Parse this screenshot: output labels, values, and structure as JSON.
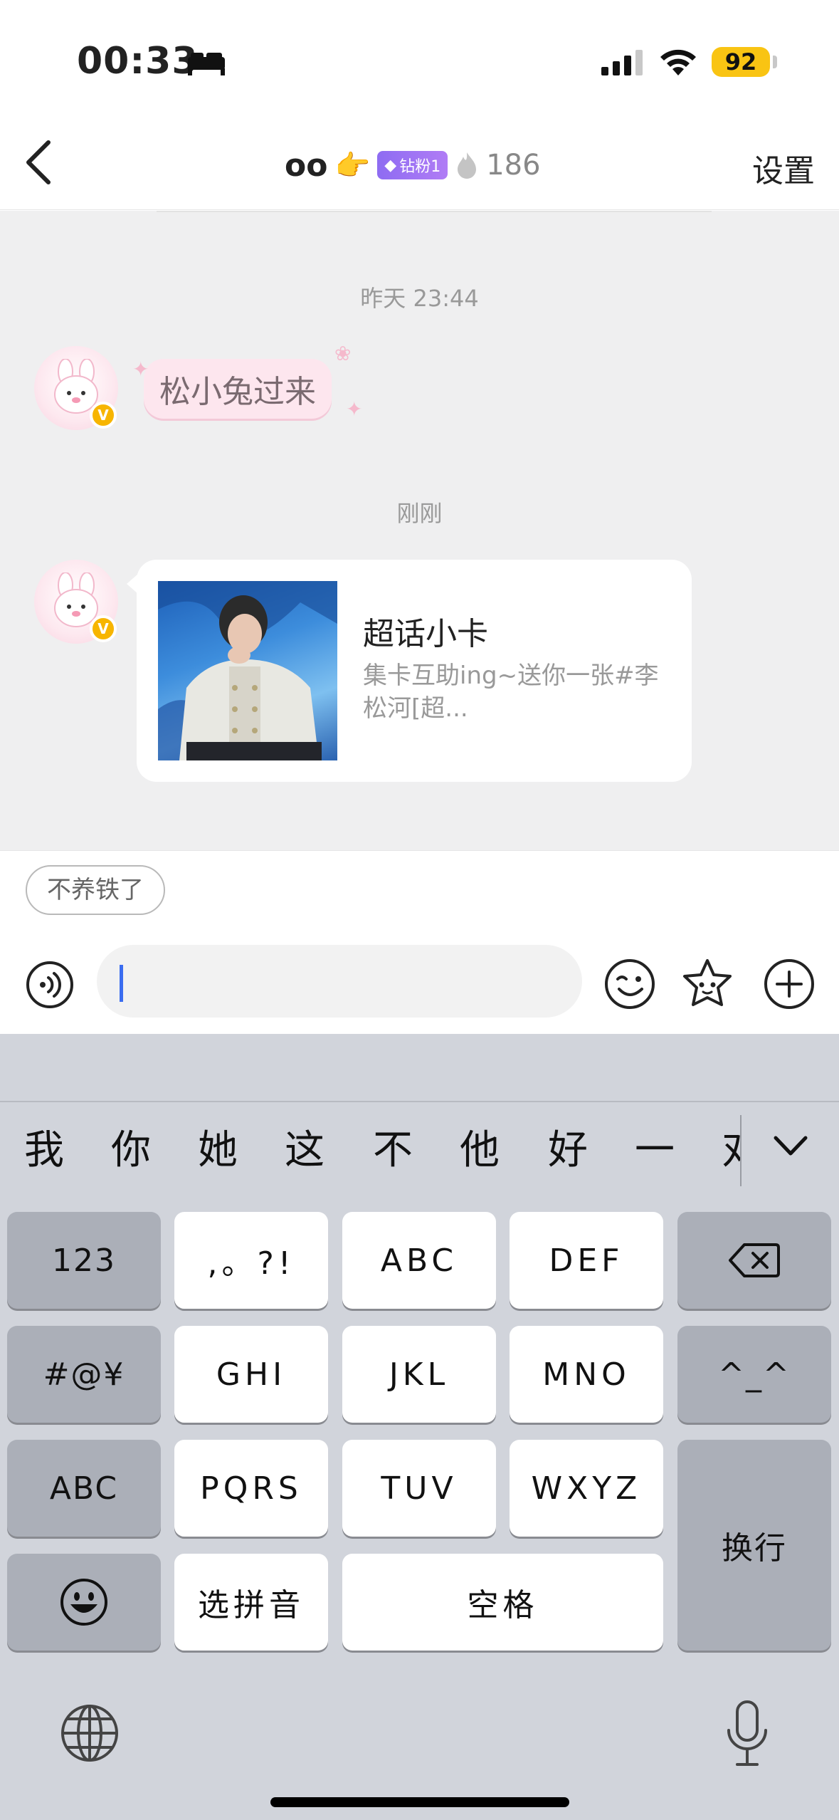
{
  "status_bar": {
    "time": "00:33",
    "battery": "92"
  },
  "nav": {
    "name": "oo",
    "name_emoji": "👉",
    "fan_badge": "钻粉1",
    "fan_count": "186",
    "settings": "设置"
  },
  "chat": {
    "messages": [
      {
        "timestamp": "昨天 23:44",
        "text": "松小兔过来"
      },
      {
        "timestamp": "刚刚",
        "card_title": "超话小卡",
        "card_desc": "集卡互助ing~送你一张#李松河[超..."
      }
    ]
  },
  "quick_reply": "不养铁了",
  "input": {
    "value": ""
  },
  "keyboard": {
    "candidates": [
      "我",
      "你",
      "她",
      "这",
      "不",
      "他",
      "好",
      "一",
      "对"
    ],
    "rows": [
      [
        "123",
        ",。?!",
        "ABC",
        "DEF"
      ],
      [
        "#@¥",
        "GHI",
        "JKL",
        "MNO",
        "^_^"
      ],
      [
        "ABC",
        "PQRS",
        "TUV",
        "WXYZ",
        "换行"
      ],
      [
        "选拼音",
        "空格"
      ]
    ]
  },
  "colors": {
    "accent": "#3b6df0",
    "vip": "#f7b500",
    "battery": "#f9c413",
    "fan_badge": "#8e6cf2"
  }
}
